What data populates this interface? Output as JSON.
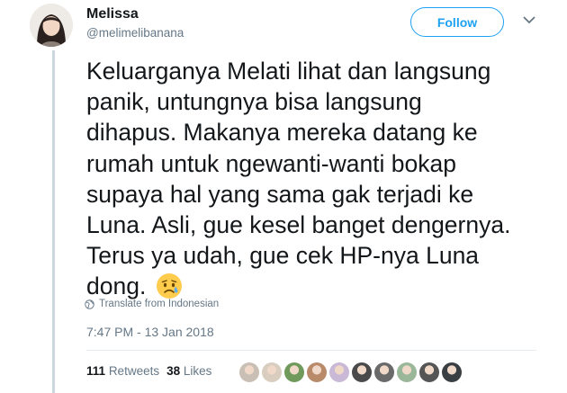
{
  "author": {
    "display_name": "Melissa",
    "handle": "@melimelibanana"
  },
  "follow_button": {
    "label": "Follow"
  },
  "tweet": {
    "text": "Keluarganya Melati lihat dan langsung\npanik, untungnya bisa langsung\ndihapus. Makanya mereka datang ke\nrumah untuk ngewanti-wanti bokap\nsupaya hal yang sama gak terjadi ke\nLuna. Asli, gue kesel banget dengernya.\nTerus ya udah, gue cek HP-nya Luna\ndong.",
    "emoji": "sad-relieved-face-emoji"
  },
  "translate": {
    "label": "Translate from Indonesian"
  },
  "timestamp": "7:47 PM - 13 Jan 2018",
  "stats": {
    "retweets_count": "111",
    "retweets_label": "Retweets",
    "likes_count": "38",
    "likes_label": "Likes"
  },
  "likers": [
    {
      "color": "#c9bfb4"
    },
    {
      "color": "#d8cdbf"
    },
    {
      "color": "#6f9a5b"
    },
    {
      "color": "#b88a6a"
    },
    {
      "color": "#c9b8d6"
    },
    {
      "color": "#4a4a4a"
    },
    {
      "color": "#6a6a6a"
    },
    {
      "color": "#9ab79a"
    },
    {
      "color": "#555555"
    },
    {
      "color": "#3a3f44"
    }
  ],
  "colors": {
    "accent": "#1da1f2",
    "secondary_text": "#657786",
    "primary_text": "#14171a"
  }
}
